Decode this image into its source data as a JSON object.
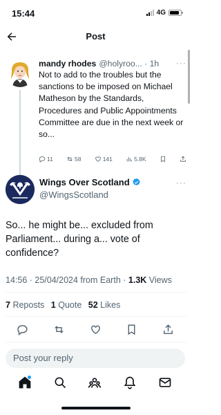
{
  "status_bar": {
    "time": "15:44",
    "network": "4G",
    "battery_level": 0.85
  },
  "header": {
    "title": "Post",
    "back_icon": "arrow-left-icon"
  },
  "reply_tweet": {
    "author_name": "mandy rhodes",
    "author_handle_time": "@holyroo... · 1h",
    "more": "···",
    "text": "Not to add to the troubles but the sanctions to be imposed on Michael Matheson by the Standards, Procedures and Public Appointments Committee are due in the next week or so...",
    "actions": {
      "replies": "11",
      "reposts": "58",
      "likes": "141",
      "views": "5.8K"
    }
  },
  "main_tweet": {
    "author_name": "Wings Over Scotland",
    "author_handle": "@WingsScotland",
    "more": "···",
    "verified_color": "#1d9bf0",
    "text": "So... he might be... excluded from Parliament... during a... vote of confidence?",
    "timestamp": "14:56 · 25/04/2024 from Earth · ",
    "views_count": "1.3K",
    "views_label": " Views",
    "stats": {
      "reposts_count": "7",
      "reposts_label": "Reposts",
      "quotes_count": "1",
      "quotes_label": "Quote",
      "likes_count": "52",
      "likes_label": "Likes"
    }
  },
  "reply_bar": {
    "placeholder": "Post your reply"
  },
  "bottom_nav": {
    "items": [
      "home-icon",
      "search-icon",
      "communities-icon",
      "notifications-icon",
      "messages-icon"
    ],
    "accent": "#1d9bf0"
  }
}
